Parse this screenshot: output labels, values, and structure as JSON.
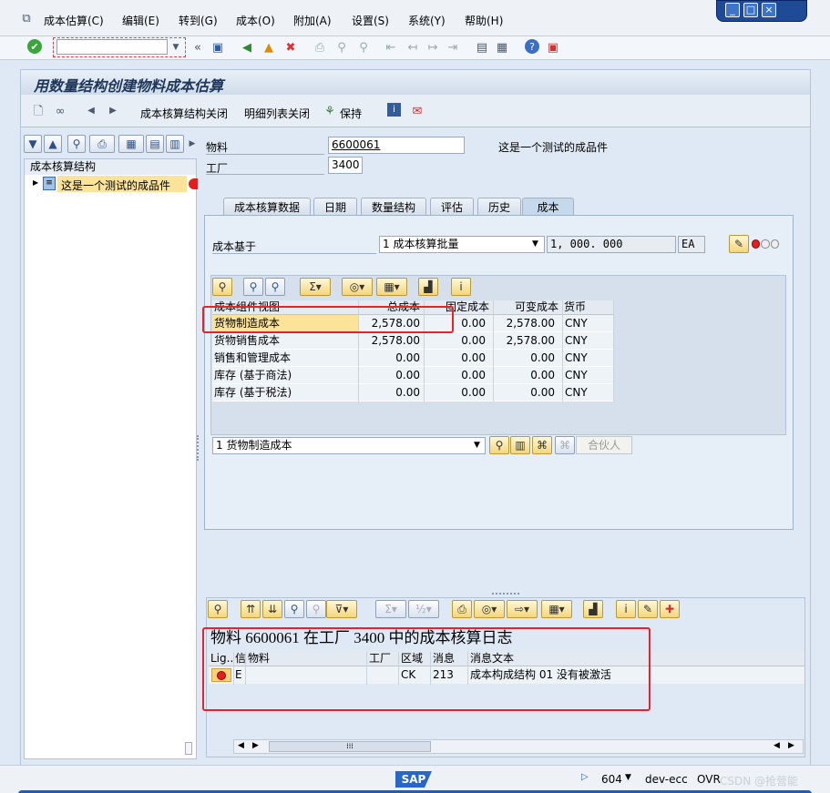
{
  "menubar": {
    "items": [
      "成本估算(C)",
      "编辑(E)",
      "转到(G)",
      "成本(O)",
      "附加(A)",
      "设置(S)",
      "系统(Y)",
      "帮助(H)"
    ]
  },
  "window_controls": [
    "_",
    "□",
    "×"
  ],
  "command_field": {
    "value": ""
  },
  "title": "用数量结构创建物料成本估算",
  "app_toolbar": {
    "close_structure": "成本核算结构关闭",
    "close_detail": "明细列表关闭",
    "keep": "保持"
  },
  "tree": {
    "header": "成本核算结构",
    "item": "这是一个测试的成品件"
  },
  "header_fields": {
    "material_label": "物料",
    "material_value": "6600061",
    "material_desc": "这是一个测试的成品件",
    "plant_label": "工厂",
    "plant_value": "3400"
  },
  "tabs": [
    "成本核算数据",
    "日期",
    "数量结构",
    "评估",
    "历史",
    "成本"
  ],
  "cost_basis": {
    "label": "成本基于",
    "select_value": "1 成本核算批量",
    "quantity": "1, 000. 000",
    "unit": "EA"
  },
  "cost_grid": {
    "headers": [
      "成本组件视图",
      "总成本",
      "固定成本",
      "可变成本",
      "货币"
    ],
    "rows": [
      [
        "货物制造成本",
        "2,578.00",
        "0.00",
        "2,578.00",
        "CNY"
      ],
      [
        "货物销售成本",
        "2,578.00",
        "0.00",
        "2,578.00",
        "CNY"
      ],
      [
        "销售和管理成本",
        "0.00",
        "0.00",
        "0.00",
        "CNY"
      ],
      [
        "库存 (基于商法)",
        "0.00",
        "0.00",
        "0.00",
        "CNY"
      ],
      [
        "库存 (基于税法)",
        "0.00",
        "0.00",
        "0.00",
        "CNY"
      ]
    ]
  },
  "view_select": {
    "value": "1 货物制造成本",
    "partner_button": "合伙人"
  },
  "log": {
    "title": "物料 6600061 在工厂 3400 中的成本核算日志",
    "headers": [
      "Lig...",
      "信",
      "物料",
      "工厂",
      "区域",
      "消息",
      "消息文本"
    ],
    "rows": [
      [
        "",
        "E",
        "",
        "",
        "CK",
        "213",
        "成本构成结构 01 没有被激活"
      ]
    ]
  },
  "statusbar": {
    "logo": "SAP",
    "session": "604",
    "system": "dev-ecc",
    "mode": "OVR",
    "watermark": "CSDN @抢营能"
  },
  "colors": {
    "highlight_box": "#e0262a",
    "selected_row": "#fbe39a",
    "error_light": "#e31e1e",
    "frame_blue": "#0a246a"
  }
}
